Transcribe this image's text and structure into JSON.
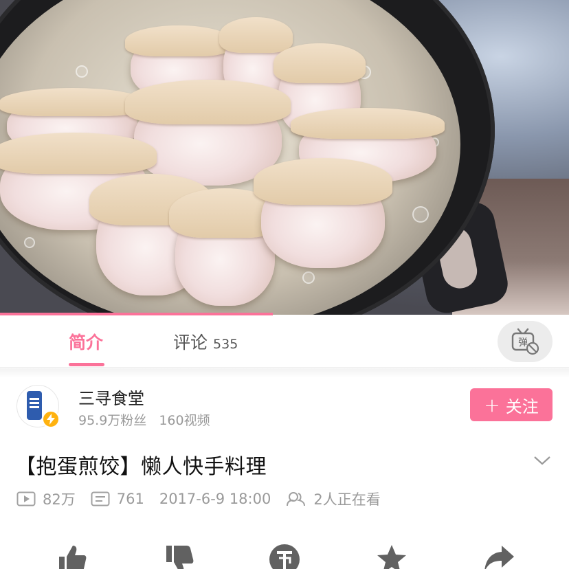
{
  "tabs": {
    "intro_label": "简介",
    "comment_label": "评论",
    "comment_count": "535",
    "active": "简介"
  },
  "danmaku": {
    "glyph": "弹",
    "icon": "danmaku-off-icon"
  },
  "playback": {
    "progress": 0.48
  },
  "uploader": {
    "name": "三寻食堂",
    "fans": "95.9万粉丝",
    "videos": "160视频",
    "follow_label": "关注",
    "follow_icon": "plus-icon",
    "verified": true
  },
  "video": {
    "title": "【抱蛋煎饺】懒人快手料理",
    "views": "82万",
    "danmaku_count": "761",
    "published": "2017-6-9 18:00",
    "watching": "2人正在看"
  },
  "action_icons": [
    "like-icon",
    "dislike-icon",
    "coin-icon",
    "favorite-icon",
    "share-icon"
  ],
  "colors": {
    "accent": "#fb7299",
    "muted": "#9a9a9a",
    "badge": "#ffb20f"
  }
}
